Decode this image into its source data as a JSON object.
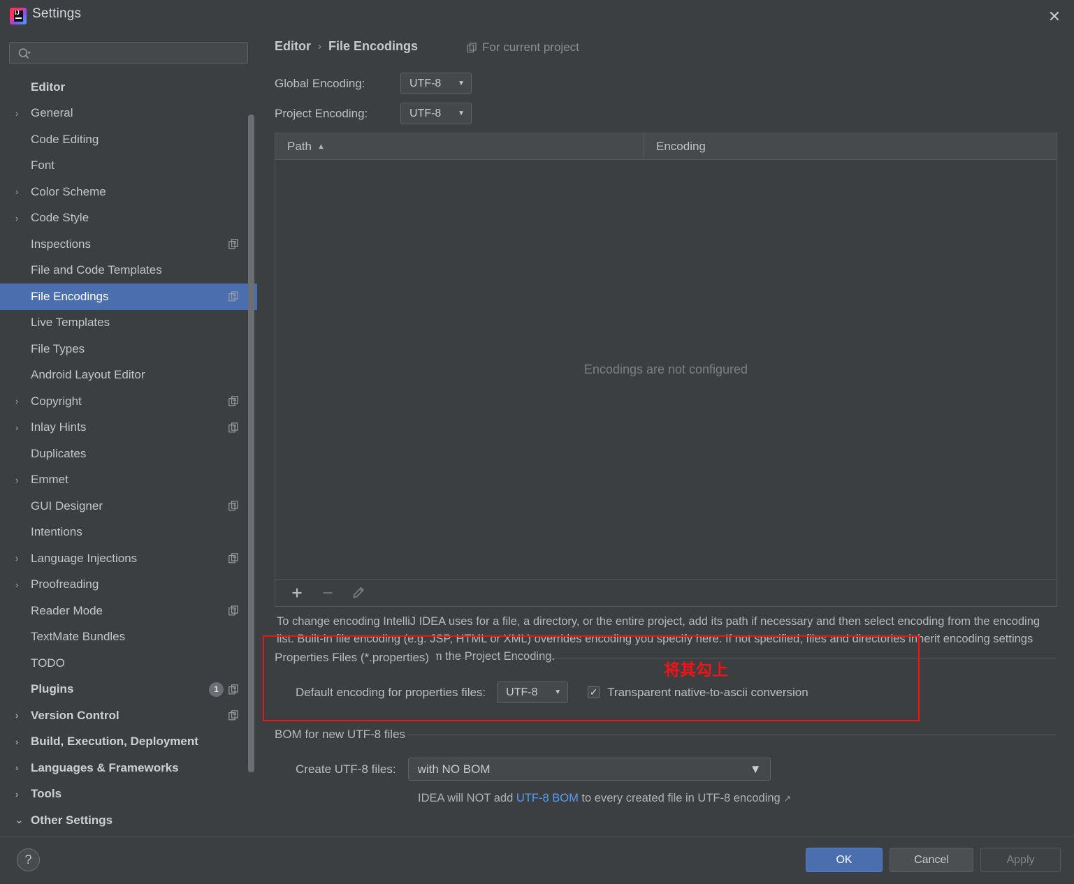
{
  "window": {
    "title": "Settings",
    "logo_text": "IJ",
    "close_icon": "close-icon"
  },
  "sidebar": {
    "search": {
      "value": "",
      "placeholder": ""
    },
    "items": [
      {
        "label": "Editor",
        "level": 0,
        "arrow": "",
        "bold": true,
        "selected": false,
        "copy": false
      },
      {
        "label": "General",
        "level": 1,
        "arrow": "›",
        "bold": false,
        "selected": false,
        "copy": false
      },
      {
        "label": "Code Editing",
        "level": 1,
        "arrow": "",
        "bold": false,
        "selected": false,
        "copy": false
      },
      {
        "label": "Font",
        "level": 1,
        "arrow": "",
        "bold": false,
        "selected": false,
        "copy": false
      },
      {
        "label": "Color Scheme",
        "level": 1,
        "arrow": "›",
        "bold": false,
        "selected": false,
        "copy": false
      },
      {
        "label": "Code Style",
        "level": 1,
        "arrow": "›",
        "bold": false,
        "selected": false,
        "copy": false
      },
      {
        "label": "Inspections",
        "level": 1,
        "arrow": "",
        "bold": false,
        "selected": false,
        "copy": true
      },
      {
        "label": "File and Code Templates",
        "level": 1,
        "arrow": "",
        "bold": false,
        "selected": false,
        "copy": false
      },
      {
        "label": "File Encodings",
        "level": 1,
        "arrow": "",
        "bold": false,
        "selected": true,
        "copy": true
      },
      {
        "label": "Live Templates",
        "level": 1,
        "arrow": "",
        "bold": false,
        "selected": false,
        "copy": false
      },
      {
        "label": "File Types",
        "level": 1,
        "arrow": "",
        "bold": false,
        "selected": false,
        "copy": false
      },
      {
        "label": "Android Layout Editor",
        "level": 1,
        "arrow": "",
        "bold": false,
        "selected": false,
        "copy": false
      },
      {
        "label": "Copyright",
        "level": 1,
        "arrow": "›",
        "bold": false,
        "selected": false,
        "copy": true
      },
      {
        "label": "Inlay Hints",
        "level": 1,
        "arrow": "›",
        "bold": false,
        "selected": false,
        "copy": true
      },
      {
        "label": "Duplicates",
        "level": 1,
        "arrow": "",
        "bold": false,
        "selected": false,
        "copy": false
      },
      {
        "label": "Emmet",
        "level": 1,
        "arrow": "›",
        "bold": false,
        "selected": false,
        "copy": false
      },
      {
        "label": "GUI Designer",
        "level": 1,
        "arrow": "",
        "bold": false,
        "selected": false,
        "copy": true
      },
      {
        "label": "Intentions",
        "level": 1,
        "arrow": "",
        "bold": false,
        "selected": false,
        "copy": false
      },
      {
        "label": "Language Injections",
        "level": 1,
        "arrow": "›",
        "bold": false,
        "selected": false,
        "copy": true
      },
      {
        "label": "Proofreading",
        "level": 1,
        "arrow": "›",
        "bold": false,
        "selected": false,
        "copy": false
      },
      {
        "label": "Reader Mode",
        "level": 1,
        "arrow": "",
        "bold": false,
        "selected": false,
        "copy": true
      },
      {
        "label": "TextMate Bundles",
        "level": 1,
        "arrow": "",
        "bold": false,
        "selected": false,
        "copy": false
      },
      {
        "label": "TODO",
        "level": 1,
        "arrow": "",
        "bold": false,
        "selected": false,
        "copy": false
      },
      {
        "label": "Plugins",
        "level": 0,
        "arrow": "",
        "bold": true,
        "selected": false,
        "copy": true,
        "badge": "1"
      },
      {
        "label": "Version Control",
        "level": 0,
        "arrow": "›",
        "bold": true,
        "selected": false,
        "copy": true
      },
      {
        "label": "Build, Execution, Deployment",
        "level": 0,
        "arrow": "›",
        "bold": true,
        "selected": false,
        "copy": false
      },
      {
        "label": "Languages & Frameworks",
        "level": 0,
        "arrow": "›",
        "bold": true,
        "selected": false,
        "copy": false
      },
      {
        "label": "Tools",
        "level": 0,
        "arrow": "›",
        "bold": true,
        "selected": false,
        "copy": false
      },
      {
        "label": "Other Settings",
        "level": 0,
        "arrow": "⌄",
        "bold": true,
        "selected": false,
        "copy": false
      }
    ]
  },
  "main": {
    "breadcrumb": {
      "parent": "Editor",
      "separator": "›",
      "current": "File Encodings"
    },
    "for_current_project": "For current project",
    "global_encoding": {
      "label": "Global Encoding:",
      "value": "UTF-8"
    },
    "project_encoding": {
      "label": "Project Encoding:",
      "value": "UTF-8"
    },
    "table": {
      "columns": [
        "Path",
        "Encoding"
      ],
      "sort_indicator": "▲",
      "rows": [],
      "empty_message": "Encodings are not configured"
    },
    "toolbar": {
      "add": "+",
      "remove": "−",
      "edit": "✎"
    },
    "description": "To change encoding IntelliJ IDEA uses for a file, a directory, or the entire project, add its path if necessary and then select encoding from the encoding list. Built-in file encoding (e.g. JSP, HTML or XML) overrides encoding you specify here. If not specified, files and directories inherit encoding settings from the parent directory or from the Project Encoding.",
    "properties_section": {
      "title": "Properties Files (*.properties)",
      "encoding_label": "Default encoding for properties files:",
      "encoding_value": "UTF-8",
      "checkbox_label": "Transparent native-to-ascii conversion",
      "checkbox_checked": true,
      "checkbox_tick": "✓"
    },
    "bom_section": {
      "title": "BOM for new UTF-8 files",
      "create_label": "Create UTF-8 files:",
      "create_value": "with NO BOM",
      "hint_prefix": "IDEA will NOT add ",
      "hint_link": "UTF-8 BOM",
      "hint_suffix": " to every created file in UTF-8 encoding ",
      "hint_external_icon": "↗"
    }
  },
  "annotation": {
    "text": "将其勾上",
    "color": "#f01414"
  },
  "footer": {
    "help": "?",
    "ok": "OK",
    "cancel": "Cancel",
    "apply": "Apply"
  }
}
